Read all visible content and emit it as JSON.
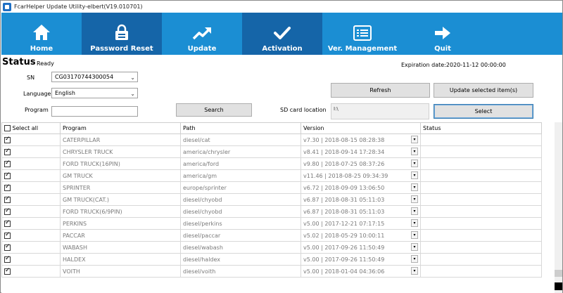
{
  "window": {
    "title": "FcarHelper Update Utility-elbert(V19.010701)"
  },
  "toolbar": {
    "items": [
      {
        "label": "Home",
        "icon": "home-icon"
      },
      {
        "label": "Password Reset",
        "icon": "lock-icon"
      },
      {
        "label": "Update",
        "icon": "trend-up-icon"
      },
      {
        "label": "Activation",
        "icon": "checkmark-icon"
      },
      {
        "label": "Ver. Management",
        "icon": "list-icon"
      },
      {
        "label": "Quit",
        "icon": "arrow-right-icon"
      }
    ],
    "colors": {
      "background": "#1b8ed3",
      "dark_tab": "#1565a8"
    }
  },
  "status": {
    "title": "Status",
    "state": "Ready",
    "expiration": "Expiration date:2020-11-12 00:00:00"
  },
  "form": {
    "sn_label": "SN",
    "sn_value": "CG03170744300054",
    "language_label": "Language",
    "language_value": "English",
    "program_label": "Program",
    "program_value": "",
    "search_label": "Search",
    "sd_label": "SD card location",
    "sd_value": "I:\\",
    "refresh_label": "Refresh",
    "update_selected_label": "Update selected item(s)",
    "select_label": "Select"
  },
  "table": {
    "headers": {
      "select_all": "Select all",
      "program": "Program",
      "path": "Path",
      "version": "Version",
      "status": "Status"
    },
    "rows": [
      {
        "checked": true,
        "program": "CATERPILLAR",
        "path": "diesel/cat",
        "version": "v7.30 | 2018-08-15 08:28:38",
        "status": ""
      },
      {
        "checked": true,
        "program": "CHRYSLER TRUCK",
        "path": "america/chrysler",
        "version": "v8.41 | 2018-09-14 17:28:34",
        "status": ""
      },
      {
        "checked": true,
        "program": "FORD TRUCK(16PIN)",
        "path": "america/ford",
        "version": "v9.80 | 2018-07-25 08:37:26",
        "status": ""
      },
      {
        "checked": true,
        "program": "GM TRUCK",
        "path": "america/gm",
        "version": "v11.46 | 2018-08-25 09:34:39",
        "status": ""
      },
      {
        "checked": true,
        "program": "SPRINTER",
        "path": "europe/sprinter",
        "version": "v6.72 | 2018-09-09 13:06:50",
        "status": ""
      },
      {
        "checked": true,
        "program": "GM TRUCK(CAT.)",
        "path": "diesel/chyobd",
        "version": "v6.87 | 2018-08-31 05:11:03",
        "status": ""
      },
      {
        "checked": true,
        "program": "FORD TRUCK(6/9PIN)",
        "path": "diesel/chyobd",
        "version": "v6.87 | 2018-08-31 05:11:03",
        "status": ""
      },
      {
        "checked": true,
        "program": "PERKINS",
        "path": "diesel/perkins",
        "version": "v5.00 | 2017-12-21 07:17:15",
        "status": ""
      },
      {
        "checked": true,
        "program": "PACCAR",
        "path": "diesel/paccar",
        "version": "v5.02 | 2018-05-29 10:00:11",
        "status": ""
      },
      {
        "checked": true,
        "program": "WABASH",
        "path": "diesel/wabash",
        "version": "v5.00 | 2017-09-26 11:50:49",
        "status": ""
      },
      {
        "checked": true,
        "program": "HALDEX",
        "path": "diesel/haldex",
        "version": "v5.00 | 2017-09-26 11:50:49",
        "status": ""
      },
      {
        "checked": true,
        "program": "VOITH",
        "path": "diesel/voith",
        "version": "v5.00 | 2018-01-04 04:36:06",
        "status": ""
      }
    ]
  }
}
